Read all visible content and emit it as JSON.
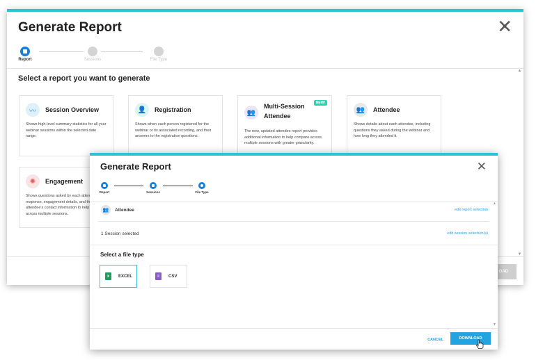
{
  "back_modal": {
    "title": "Generate Report",
    "close_glyph": "✕",
    "stepper": [
      {
        "label": "Report",
        "state": "active"
      },
      {
        "label": "Sessions",
        "state": "inactive"
      },
      {
        "label": "File Type",
        "state": "inactive"
      }
    ],
    "subtitle": "Select a report you want to generate",
    "download_label": "OAD",
    "cards": [
      {
        "title": "Session Overview",
        "desc": "Shows high-level summary statistics for all your webinar sessions within the selected date range.",
        "icon": "trend-line-icon",
        "icon_color": "#2c9fe0",
        "icon_bg": "#def1fb",
        "glyph": "〰"
      },
      {
        "title": "Registration",
        "desc": "Shows when each person registered for the webinar or its associated recording, and their answers to the registration questions.",
        "icon": "person-add-icon",
        "icon_color": "#16a88d",
        "icon_bg": "#d9f5ee",
        "glyph": "👤"
      },
      {
        "title": "Multi-Session Attendee",
        "desc": "The new, updated attendee report provides additional information to help compare across multiple sessions with greater granularity.",
        "badge": "NEW!",
        "icon": "people-icon",
        "icon_color": "#8b5cc8",
        "icon_bg": "#ece3f7",
        "glyph": "👥"
      },
      {
        "title": "Attendee",
        "desc": "Shows details about each attendee, including questions they asked during the webinar and how long they attended it.",
        "icon": "people-icon",
        "icon_color": "#666666",
        "icon_bg": "#e8e8e8",
        "glyph": "👥"
      },
      {
        "title": "Engagement",
        "desc": "Shows questions asked by each attendee, your response, engagement details, and the attendee's contact information to help compare across multiple sessions.",
        "icon": "bulb-icon",
        "icon_color": "#e05a5a",
        "icon_bg": "#fbe3e3",
        "glyph": "✺"
      }
    ]
  },
  "front_modal": {
    "title": "Generate Report",
    "close_glyph": "✕",
    "stepper": [
      {
        "label": "Report"
      },
      {
        "label": "Sessions"
      },
      {
        "label": "File Type"
      }
    ],
    "rows": [
      {
        "text": "Attendee",
        "link": "edit report selection"
      },
      {
        "text": "1 Session selected",
        "link": "edit session selection(s)"
      }
    ],
    "subtitle": "Select a file type",
    "file_types": [
      {
        "label": "EXCEL",
        "selected": true,
        "icon_color": "#1f9b5c"
      },
      {
        "label": "CSV",
        "selected": false,
        "icon_color": "#8b5cc8"
      }
    ],
    "cancel_label": "CANCEL",
    "download_label": "DOWNLOAD"
  }
}
